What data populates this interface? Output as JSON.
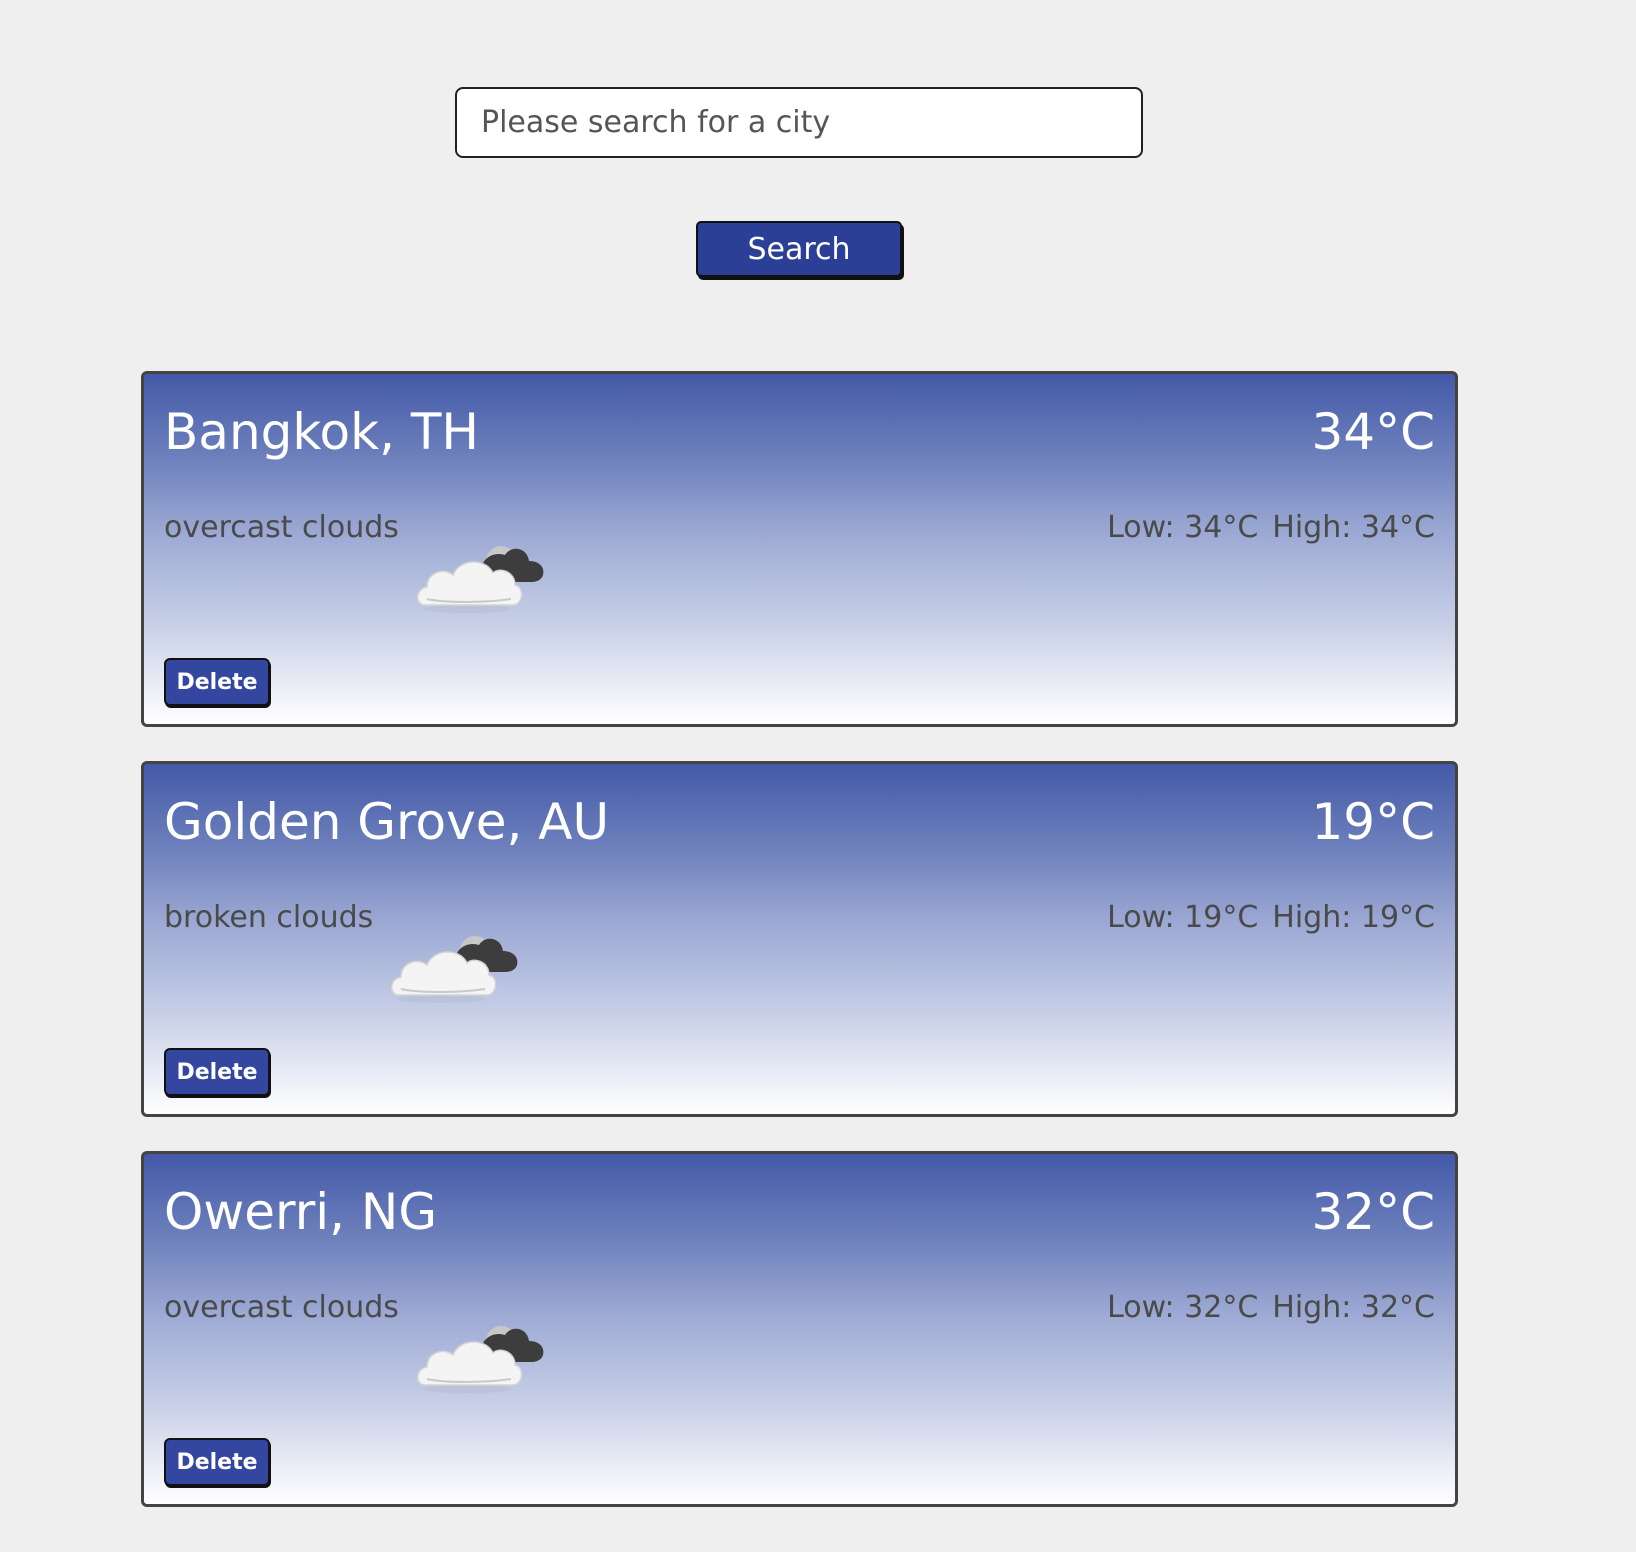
{
  "search": {
    "placeholder": "Please search for a city",
    "value": "",
    "button_label": "Search"
  },
  "cards": [
    {
      "city": "Bangkok, TH",
      "temp": "34°C",
      "description": "overcast clouds",
      "low": "Low: 34°C",
      "high": "High: 34°C",
      "icon": "overcast-clouds-icon",
      "delete_label": "Delete"
    },
    {
      "city": "Golden Grove, AU",
      "temp": "19°C",
      "description": "broken clouds",
      "low": "Low: 19°C",
      "high": "High: 19°C",
      "icon": "broken-clouds-icon",
      "delete_label": "Delete"
    },
    {
      "city": "Owerri, NG",
      "temp": "32°C",
      "description": "overcast clouds",
      "low": "Low: 32°C",
      "high": "High: 32°C",
      "icon": "overcast-clouds-icon",
      "delete_label": "Delete"
    }
  ],
  "colors": {
    "page_background": "#efefef",
    "button_blue": "#2c3f96",
    "card_gradient_top": "#4459a8",
    "card_gradient_bottom": "#ffffff"
  }
}
